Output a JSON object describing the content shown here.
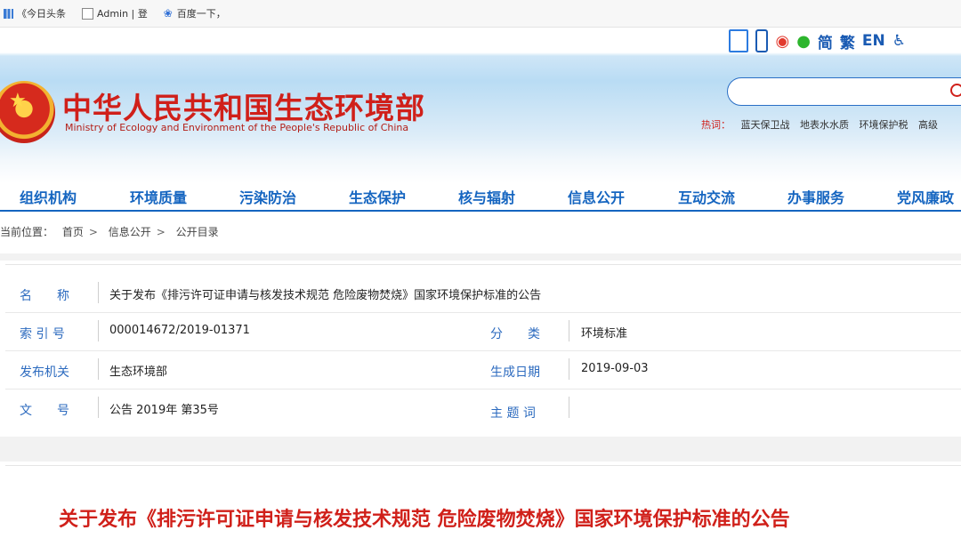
{
  "bookmarks": [
    {
      "label": "《今日头条",
      "icon": "bar-chart-icon"
    },
    {
      "label": "Admin | 登",
      "icon": "document-icon"
    },
    {
      "label": "百度一下，",
      "icon": "paw-icon"
    }
  ],
  "header": {
    "utilities": {
      "simplified": "简",
      "traditional": "繁",
      "english": "EN",
      "accessibility": "♿"
    },
    "ministry_cn": "中华人民共和国生态环境部",
    "ministry_en": "Ministry of Ecology and Environment of the People's Republic of China",
    "search_placeholder": "",
    "hotwords_label": "热词：",
    "hotwords": [
      "蓝天保卫战",
      "地表水水质",
      "环境保护税",
      "高级"
    ]
  },
  "nav": [
    "组织机构",
    "环境质量",
    "污染防治",
    "生态保护",
    "核与辐射",
    "信息公开",
    "互动交流",
    "办事服务",
    "党风廉政"
  ],
  "breadcrumb": {
    "label": "当前位置：",
    "items": [
      "首页",
      "信息公开",
      "公开目录"
    ],
    "separator": ">"
  },
  "info": {
    "name_label": "名　　称",
    "name_value": "关于发布《排污许可证申请与核发技术规范 危险废物焚烧》国家环境保护标准的公告",
    "index_label": "索 引 号",
    "index_value": "000014672/2019-01371",
    "category_label": "分　　类",
    "category_value": "环境标准",
    "publisher_label": "发布机关",
    "publisher_value": "生态环境部",
    "date_label": "生成日期",
    "date_value": "2019-09-03",
    "doc_no_label": "文　　号",
    "doc_no_value": "公告 2019年 第35号",
    "keywords_label": "主 题 词",
    "keywords_value": ""
  },
  "article": {
    "title": "关于发布《排污许可证申请与核发技术规范 危险废物焚烧》国家环境保护标准的公告"
  },
  "colors": {
    "brand_red": "#d0201a",
    "nav_blue": "#1565c0",
    "label_blue": "#2d6bbf"
  }
}
